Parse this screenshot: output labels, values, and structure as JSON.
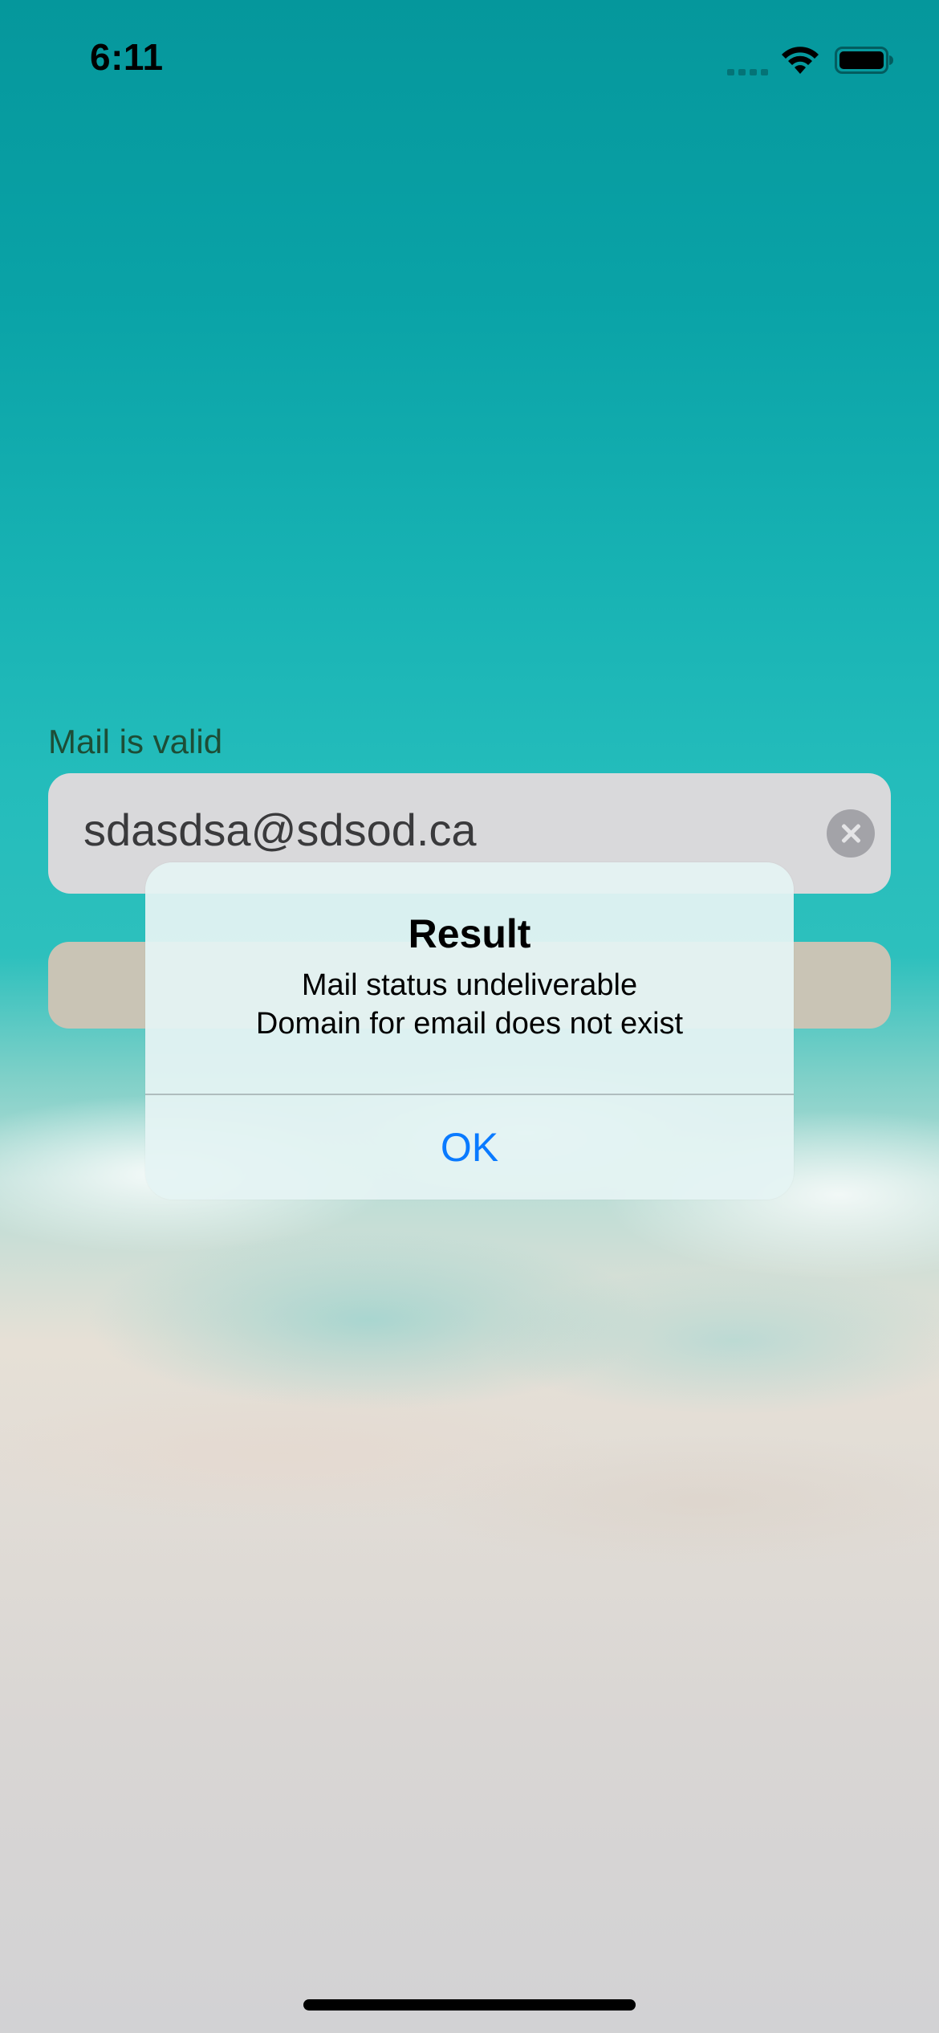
{
  "status_bar": {
    "time": "6:11",
    "icons": [
      "signal-icon",
      "wifi-icon",
      "battery-icon"
    ]
  },
  "form": {
    "validation_label": "Mail is valid",
    "email_value": "sdasdsa@sdsod.ca",
    "clear_icon": "clear-icon"
  },
  "alert": {
    "title": "Result",
    "message_line1": "Mail status undeliverable",
    "message_line2": "Domain for email does not exist",
    "ok_label": "OK"
  },
  "colors": {
    "accent": "#0A7AFF",
    "validation_text": "#1D4D36",
    "button": "#C9C4B5"
  }
}
